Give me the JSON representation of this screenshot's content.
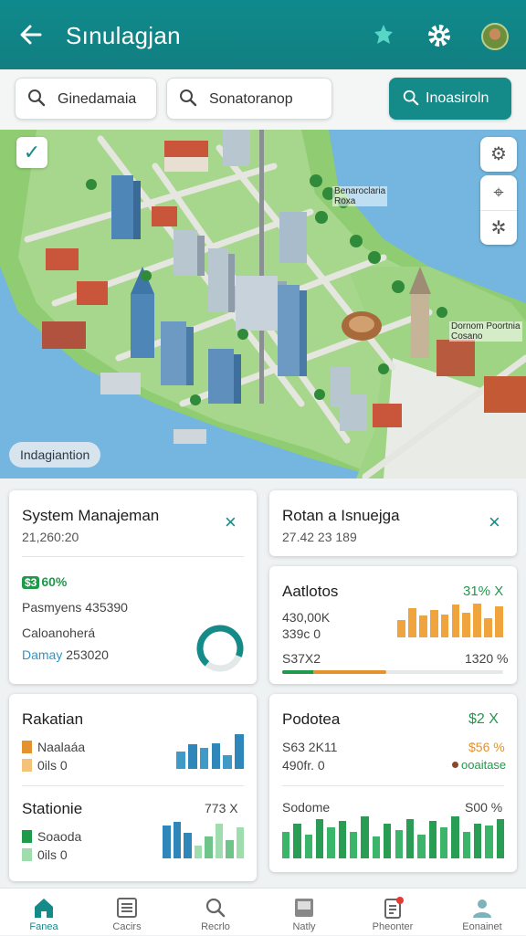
{
  "header": {
    "title": "Sınulagjan",
    "icons": [
      "back-arrow-icon",
      "puzzle-star-icon",
      "gear-icon",
      "avatar"
    ]
  },
  "search": {
    "field1_value": "Ginedamaia",
    "field2_value": "Sonatoranop",
    "button_label": "Inoasiroln"
  },
  "map": {
    "location_chip": "Indagiantion",
    "label_top": "Benaroclaria\nRoxa",
    "label_right": "Dornom Poortnia\nCosano"
  },
  "colors": {
    "accent": "#148a89",
    "green": "#1f9a4a",
    "orange": "#e3922f",
    "blue": "#2b95c8"
  },
  "cards": {
    "system": {
      "title": "System Manajeman",
      "subtitle": "21,260:20",
      "badge_pill": "$3",
      "badge_text": "60%",
      "line1": "Pasmyens 435390",
      "line2": "Caloanoherá",
      "line3_label": "Damay",
      "line3_value": "253020",
      "gauge_percent": 70
    },
    "rotan": {
      "title": "Rotan a Isnuejga",
      "subtitle": "27.42 23 189"
    },
    "aatlotos": {
      "title": "Aatlotos",
      "value": "31% X",
      "line1": "430,00K",
      "line2": "339c 0",
      "footer_left": "S37X2",
      "footer_right": "1320 %",
      "progress_percent": 47,
      "bars": [
        0.5,
        0.85,
        0.62,
        0.78,
        0.65,
        0.95,
        0.7,
        0.98,
        0.55,
        0.9
      ]
    },
    "rakatian": {
      "title": "Rakatian",
      "legend1": "Naalaáa",
      "legend2": "0ils",
      "legend2_value": "0",
      "bars": [
        0.5,
        0.7,
        0.6,
        0.75,
        0.4,
        1.0
      ]
    },
    "podotea": {
      "title": "Podotea",
      "value": "$2 X",
      "line1": "S63 2K11",
      "line2": "490fr. 0",
      "side1": "$56 %",
      "side2": "ooaitase"
    },
    "stationie": {
      "title": "Stationie",
      "value": "773 X",
      "legend1": "Soaoda",
      "legend2": "0ils",
      "legend2_value": "0",
      "bars": [
        0.9,
        1.0,
        0.7,
        0.35,
        0.6,
        0.95,
        0.5,
        0.85
      ]
    },
    "sodome": {
      "title": "Sodome",
      "value": "S00 %",
      "bars": [
        0.6,
        0.8,
        0.55,
        0.9,
        0.7,
        0.85,
        0.6,
        0.95,
        0.5,
        0.8,
        0.65,
        0.9,
        0.55,
        0.85,
        0.7,
        0.95,
        0.6,
        0.8,
        0.75,
        0.9
      ]
    }
  },
  "nav": {
    "items": [
      {
        "label": "Fanea",
        "icon": "home-icon"
      },
      {
        "label": "Cacirs",
        "icon": "list-icon"
      },
      {
        "label": "Recrlo",
        "icon": "search-icon"
      },
      {
        "label": "Natly",
        "icon": "inbox-icon"
      },
      {
        "label": "Pheonter",
        "icon": "notification-document-icon"
      },
      {
        "label": "Eonainet",
        "icon": "profile-icon"
      }
    ]
  }
}
